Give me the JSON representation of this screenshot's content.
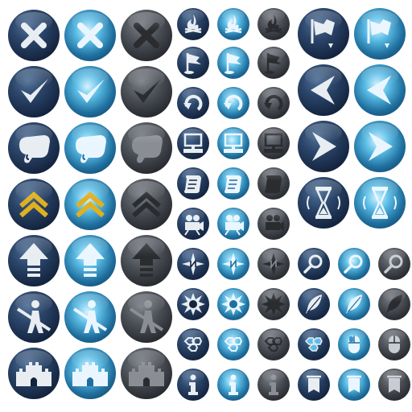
{
  "themes": {
    "navy": "#14243f",
    "cyan": "#1f6f9e",
    "dark": "#2b2e33",
    "glyph": "#e8edf2",
    "gold": "#e0b020"
  },
  "icon_sets": {
    "large_left": [
      "close-icon",
      "checkmark-icon",
      "grab-hand-icon",
      "double-chevron-up-icon",
      "upload-arrow-icon",
      "pedestrian-blocked-icon",
      "castle-icon"
    ],
    "small_middle": [
      "campfire-icon",
      "flag-marker-icon",
      "rotate-icon",
      "computer-icon",
      "scroll-icon",
      "movie-camera-icon",
      "compass-icon",
      "explosion-icon",
      "hexagon-grid-icon",
      "info-icon"
    ],
    "large_right": [
      "flag-drop-icon",
      "arrow-left-icon",
      "arrow-right-icon",
      "hourglass-icon"
    ],
    "small_right": [
      "magnifier-icon",
      "feather-icon",
      "hexagon-grid-icon",
      "mouse-icon",
      "banner-icon"
    ]
  }
}
